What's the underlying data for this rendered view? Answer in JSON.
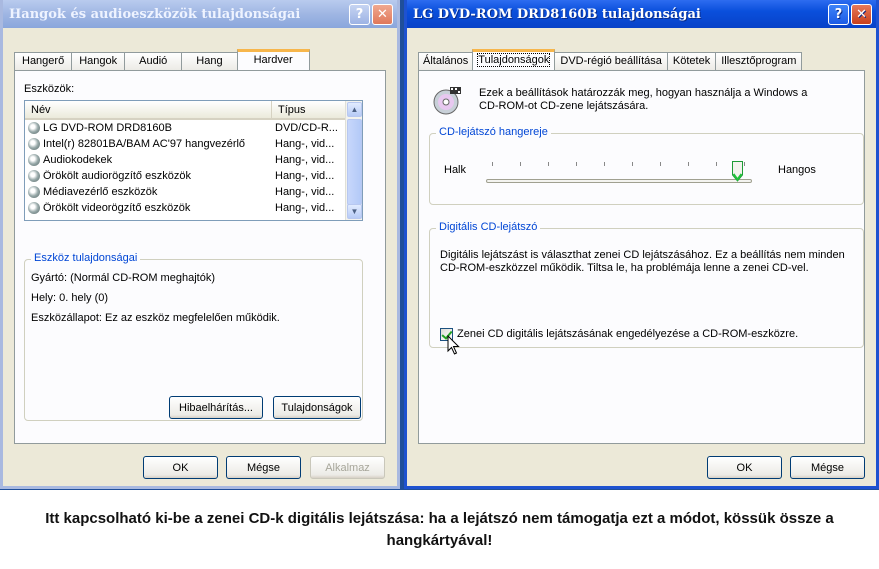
{
  "left_window": {
    "title": "Hangok és audioeszközök tulajdonságai",
    "tabs": [
      "Hangerő",
      "Hangok",
      "Audió",
      "Hang",
      "Hardver"
    ],
    "devices_label": "Eszközök:",
    "columns": [
      "Név",
      "Típus"
    ],
    "devices": [
      {
        "name": "LG DVD-ROM DRD8160B",
        "type": "DVD/CD-R..."
      },
      {
        "name": "Intel(r) 82801BA/BAM AC'97 hangvezérlő",
        "type": "Hang-, vid..."
      },
      {
        "name": "Audiokodekek",
        "type": "Hang-, vid..."
      },
      {
        "name": "Örökölt audiorögzítő eszközök",
        "type": "Hang-, vid..."
      },
      {
        "name": "Médiavezérlő eszközök",
        "type": "Hang-, vid..."
      },
      {
        "name": "Örökölt videorögzítő eszközök",
        "type": "Hang-, vid..."
      }
    ],
    "props_legend": "Eszköz tulajdonságai",
    "manufacturer": "Gyártó: (Normál CD-ROM meghajtók)",
    "location": "Hely: 0. hely (0)",
    "status": "Eszközállapot: Ez az eszköz megfelelően működik.",
    "troubleshoot_btn": "Hibaelhárítás...",
    "properties_btn": "Tulajdonságok",
    "ok": "OK",
    "cancel": "Mégse",
    "apply": "Alkalmaz"
  },
  "right_window": {
    "title": "LG DVD-ROM DRD8160B tulajdonságai",
    "tabs": [
      "Általános",
      "Tulajdonságok",
      "DVD-régió beállítása",
      "Kötetek",
      "Illesztőprogram"
    ],
    "intro": "Ezek a beállítások határozzák meg, hogyan használja a Windows a CD-ROM-ot CD-zene lejátszására.",
    "volume_legend": "CD-lejátszó hangereje",
    "low": "Halk",
    "high": "Hangos",
    "volume_level": 0.95,
    "digital_legend": "Digitális CD-lejátszó",
    "digital_desc": "Digitális lejátszást is választhat zenei CD lejátszásához. Ez a beállítás nem minden CD-ROM-eszközzel működik. Tiltsa le, ha problémája lenne a zenei CD-vel.",
    "checkbox_label": "Zenei CD digitális lejátszásának engedélyezése a CD-ROM-eszközre.",
    "checkbox_checked": true,
    "ok": "OK",
    "cancel": "Mégse"
  },
  "caption": "Itt kapcsolható ki-be a zenei CD-k digitális lejátszása: ha a lejátszó nem támogatja ezt a módot, kössük össze a hangkártyával!"
}
